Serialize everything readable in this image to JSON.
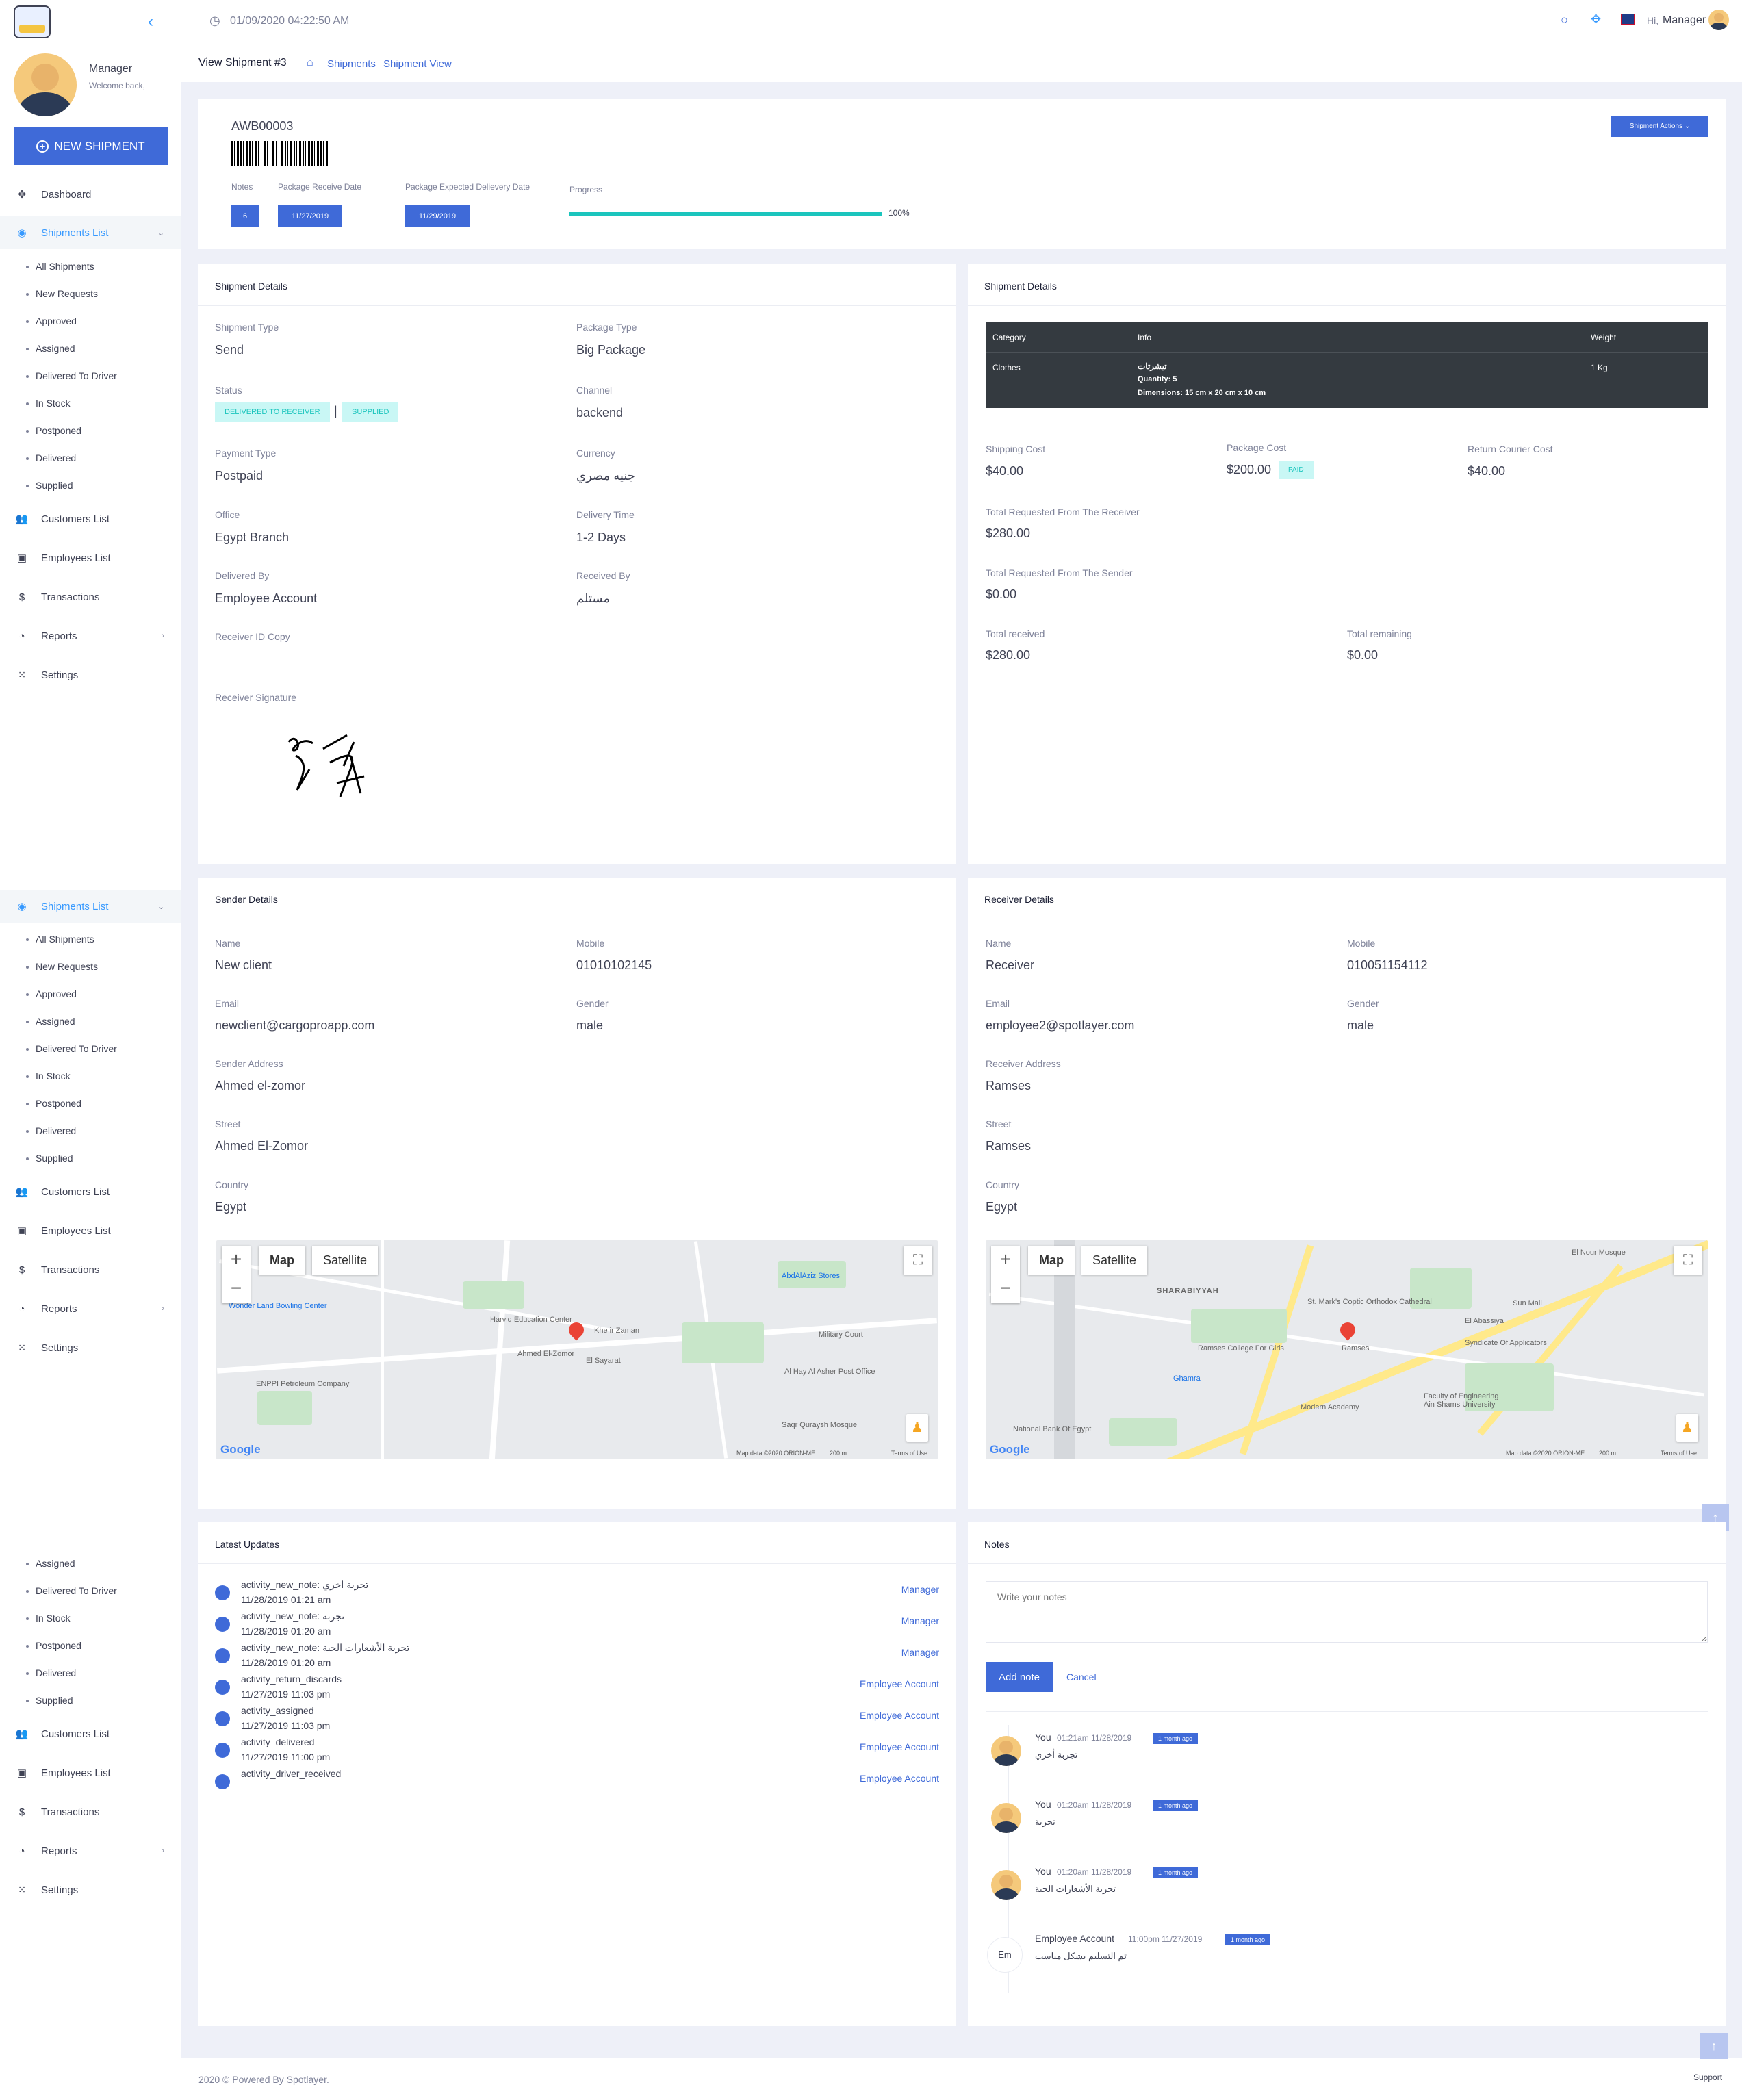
{
  "topbar": {
    "datetime": "01/09/2020 04:22:50 AM",
    "greeting": "Hi,",
    "user": "Manager"
  },
  "subheader": {
    "page_title": "View Shipment #3",
    "crumb_1": "Shipments",
    "crumb_2": "Shipment View"
  },
  "sidebar": {
    "user_name": "Manager",
    "welcome": "Welcome back,",
    "new_shipment": "NEW SHIPMENT",
    "dashboard": "Dashboard",
    "shipments_list": "Shipments List",
    "sub_items": [
      "All Shipments",
      "New Requests",
      "Approved",
      "Assigned",
      "Delivered To Driver",
      "In Stock",
      "Postponed",
      "Delivered",
      "Supplied"
    ],
    "customers": "Customers List",
    "employees": "Employees List",
    "transactions": "Transactions",
    "reports": "Reports",
    "settings": "Settings"
  },
  "awb": {
    "code": "AWB00003",
    "actions": "Shipment Actions",
    "notes_label": "Notes",
    "notes_count": "6",
    "receive_label": "Package Receive Date",
    "receive_date": "11/27/2019",
    "expected_label": "Package Expected Delievery Date",
    "expected_date": "11/29/2019",
    "progress_label": "Progress",
    "progress_pct": "100%",
    "progress": 1.0
  },
  "shipment_details": {
    "title": "Shipment Details",
    "type_label": "Shipment Type",
    "type": "Send",
    "pkg_label": "Package Type",
    "pkg": "Big Package",
    "status_label": "Status",
    "status_1": "DELIVERED TO RECEIVER",
    "status_2": "SUPPLIED",
    "channel_label": "Channel",
    "channel": "backend",
    "payment_label": "Payment Type",
    "payment": "Postpaid",
    "currency_label": "Currency",
    "currency": "جنيه مصري",
    "office_label": "Office",
    "office": "Egypt Branch",
    "delivery_label": "Delivery Time",
    "delivery": "1-2 Days",
    "delivered_by_label": "Delivered By",
    "delivered_by": "Employee Account",
    "received_by_label": "Received By",
    "received_by": "مستلم",
    "id_copy_label": "Receiver ID Copy",
    "signature_label": "Receiver Signature"
  },
  "shipment_costs": {
    "title": "Shipment Details",
    "th_category": "Category",
    "th_info": "Info",
    "th_weight": "Weight",
    "row_category": "Clothes",
    "row_info_name": "تيشرتات",
    "row_info_qty": "Quantity: 5",
    "row_info_dim": "Dimensions: 15 cm x 20 cm x 10 cm",
    "row_weight": "1 Kg",
    "shipping_label": "Shipping Cost",
    "shipping": "$40.00",
    "package_label": "Package Cost",
    "package": "$200.00",
    "paid": "PAID",
    "return_label": "Return Courier Cost",
    "return": "$40.00",
    "req_receiver_label": "Total Requested From The Receiver",
    "req_receiver": "$280.00",
    "req_sender_label": "Total Requested From The Sender",
    "req_sender": "$0.00",
    "received_label": "Total received",
    "received": "$280.00",
    "remaining_label": "Total remaining",
    "remaining": "$0.00"
  },
  "sender": {
    "title": "Sender Details",
    "name_label": "Name",
    "name": "New client",
    "mobile_label": "Mobile",
    "mobile": "01010102145",
    "email_label": "Email",
    "email": "newclient@cargoproapp.com",
    "gender_label": "Gender",
    "gender": "male",
    "address_label": "Sender Address",
    "address": "Ahmed el-zomor",
    "street_label": "Street",
    "street": "Ahmed El-Zomor",
    "country_label": "Country",
    "country": "Egypt"
  },
  "receiver": {
    "title": "Receiver Details",
    "name_label": "Name",
    "name": "Receiver",
    "mobile_label": "Mobile",
    "mobile": "010051154112",
    "email_label": "Email",
    "email": "employee2@spotlayer.com",
    "gender_label": "Gender",
    "gender": "male",
    "address_label": "Receiver Address",
    "address": "Ramses",
    "street_label": "Street",
    "street": "Ramses",
    "country_label": "Country",
    "country": "Egypt"
  },
  "map": {
    "tab_map": "Map",
    "tab_sat": "Satellite",
    "google": "Google",
    "data": "Map data ©2020 ORION-ME",
    "scale": "200 m",
    "terms": "Terms of Use",
    "sender_labels": [
      "Harvid Education Center",
      "Khe ir Zaman",
      "El Sayarat",
      "Military Court",
      "Wonder Land Bowling Center",
      "ENPPI Petroleum Company",
      "Al Hay Al Asher Post Office",
      "Saqr Quraysh Mosque",
      "AbdAlAziz Stores",
      "Ahmed El-Zomor"
    ],
    "receiver_labels": [
      "SHARABIYYAH",
      "St. Mark's Coptic Orthodox Cathedral",
      "El Abassiya",
      "Sun Mall",
      "Ramses College For Girls",
      "Ghamra",
      "Modern Academy",
      "Faculty of Engineering Ain Shams University",
      "Syndicate Of Applicators",
      "National Bank Of Egypt",
      "El Nour Mosque",
      "Ramses"
    ]
  },
  "updates": {
    "title": "Latest Updates",
    "items": [
      {
        "a": "activity_new_note: تجربة أخري",
        "t": "11/28/2019 01:21 am",
        "by": "Manager"
      },
      {
        "a": "activity_new_note: تجربة",
        "t": "11/28/2019 01:20 am",
        "by": "Manager"
      },
      {
        "a": "activity_new_note: تجربة الأشعارات الحية",
        "t": "11/28/2019 01:20 am",
        "by": "Manager"
      },
      {
        "a": "activity_return_discards",
        "t": "11/27/2019 11:03 pm",
        "by": "Employee Account"
      },
      {
        "a": "activity_assigned",
        "t": "11/27/2019 11:03 pm",
        "by": "Employee Account"
      },
      {
        "a": "activity_delivered",
        "t": "11/27/2019 11:00 pm",
        "by": "Employee Account"
      },
      {
        "a": "activity_driver_received",
        "t": "",
        "by": "Employee Account"
      }
    ]
  },
  "notes": {
    "title": "Notes",
    "placeholder": "Write your notes",
    "add": "Add note",
    "cancel": "Cancel",
    "items": [
      {
        "who": "You",
        "tm": "01:21am 11/28/2019",
        "ago": "1 month ago",
        "txt": "تجربة أخري"
      },
      {
        "who": "You",
        "tm": "01:20am 11/28/2019",
        "ago": "1 month ago",
        "txt": "تجربة"
      },
      {
        "who": "You",
        "tm": "01:20am 11/28/2019",
        "ago": "1 month ago",
        "txt": "تجربة الأشعارات الحية"
      },
      {
        "who": "Employee Account",
        "tm": "11:00pm 11/27/2019",
        "ago": "1 month ago",
        "txt": "تم التسليم بشكل مناسب",
        "initials": "Em"
      }
    ]
  },
  "footer": {
    "copyright": "2020 © Powered By Spotlayer.",
    "support": "Support"
  }
}
